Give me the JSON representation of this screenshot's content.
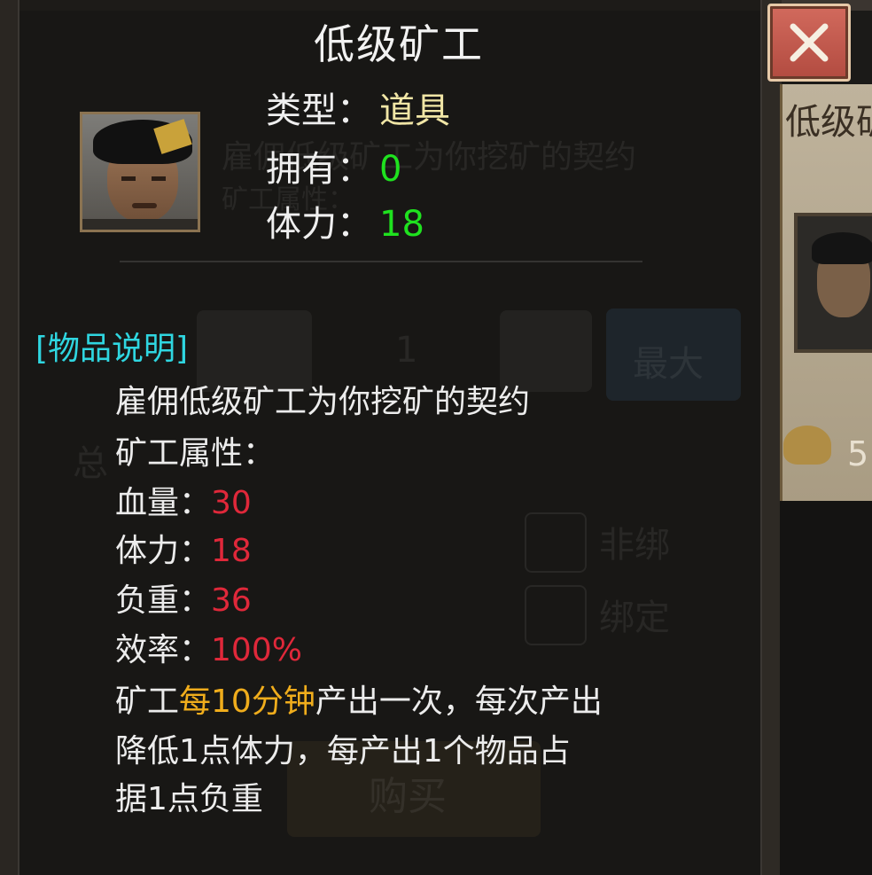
{
  "title": "低级矿工",
  "attributes": [
    {
      "label": "类型",
      "sep": "：",
      "value": "道具",
      "value_color": "#f1e6a6"
    },
    {
      "label": "拥有",
      "sep": "：",
      "value": "0",
      "value_color": "#1fe21f"
    },
    {
      "label": "体力",
      "sep": "：",
      "value": "18",
      "value_color": "#1fe21f"
    }
  ],
  "section_title": "[物品说明]",
  "description": "雇佣低级矿工为你挖矿的契约",
  "miner_attr_header": "矿工属性：",
  "stats": [
    {
      "label": "血量",
      "sep": "：",
      "value": "30"
    },
    {
      "label": "体力",
      "sep": "：",
      "value": "18"
    },
    {
      "label": "负重",
      "sep": "：",
      "value": "36"
    },
    {
      "label": "效率",
      "sep": "：",
      "value": "100%"
    }
  ],
  "note": {
    "prefix": "矿工",
    "highlight": "每10分钟",
    "suffix": "产出一次，每次产出",
    "line2": "降低1点体力，每产出1个物品占",
    "line3": "据1点负重"
  },
  "background": {
    "right_title": "低级矿",
    "right_gold": "5",
    "ghost_desc": "雇佣低级矿工为你挖矿的契约",
    "ghost_attr": "矿工属性：",
    "ghost_qty": "1",
    "ghost_max": "最大",
    "ghost_total": "总",
    "ghost_unbound": "非绑",
    "ghost_bound": "绑定",
    "ghost_buy": "购买"
  },
  "colors": {
    "accent_cyan": "#2fd6e0",
    "stat_red": "#e0283a",
    "highlight_orange": "#f0ad1c",
    "value_green": "#1fe21f"
  },
  "icons": {
    "close": "close-x-icon",
    "portrait": "miner-portrait"
  }
}
